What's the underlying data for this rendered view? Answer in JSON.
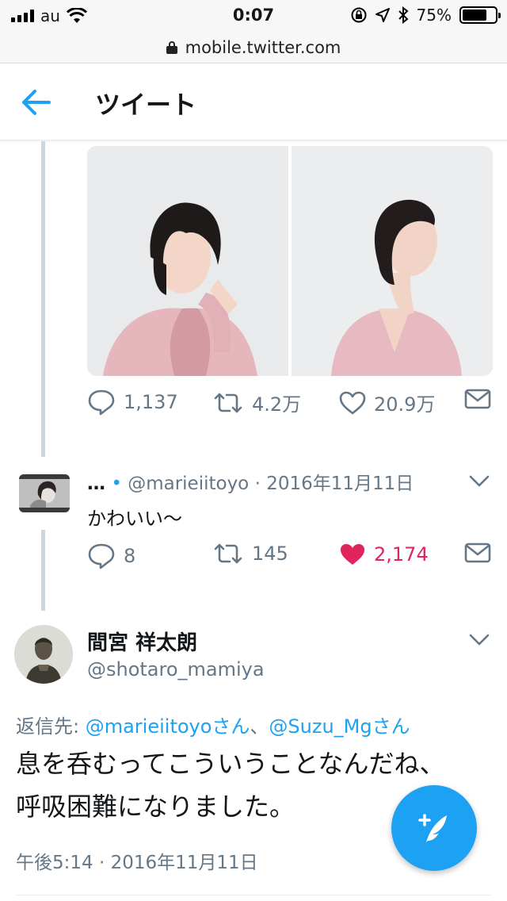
{
  "status_bar": {
    "carrier": "au",
    "time": "0:07",
    "battery_percent": "75%",
    "battery_level": 0.75
  },
  "url_bar": {
    "domain": "mobile.twitter.com"
  },
  "header": {
    "title": "ツイート"
  },
  "quoted_tweet": {
    "replies": "1,137",
    "retweets": "4.2万",
    "likes": "20.9万"
  },
  "reply_tweet": {
    "name": "…",
    "handle": "@marieiitoyo",
    "date": "2016年11月11日",
    "text": "かわいい〜",
    "replies": "8",
    "retweets": "145",
    "likes": "2,174"
  },
  "main_tweet": {
    "name": "間宮 祥太朗",
    "handle": "@shotaro_mamiya",
    "reply_prefix": "返信先: ",
    "reply_to_1": "@marieiitoyoさん",
    "reply_sep": "、",
    "reply_to_2": "@Suzu_Mgさん",
    "text": "息を呑むってこういうことなんだね、呼吸困難になりました。",
    "timestamp": "午後5:14 · 2016年11月11日"
  },
  "colors": {
    "accent": "#1da1f2",
    "like": "#e0245e",
    "muted": "#657786"
  }
}
